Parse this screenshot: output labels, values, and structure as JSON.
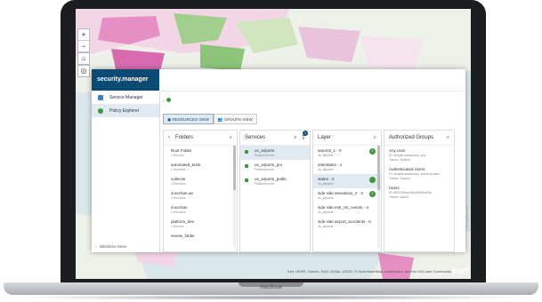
{
  "device": {
    "label": "MacBook"
  },
  "map": {
    "zoom_in": "+",
    "zoom_out": "−",
    "home": "⌂",
    "locate": "◎",
    "attribution": "Esri, HERE, Garmin, FAO, NOAA, USGS, © OpenStreetMap contributors, and the GIS User Community",
    "logo": "esri"
  },
  "app": {
    "brand": "security.manager",
    "nav": [
      {
        "label": "Service Manager"
      },
      {
        "label": "Policy Explorer"
      }
    ],
    "minimize": "Minimize menu",
    "breadcrumb": "",
    "tabs": [
      {
        "label": "RESOURCES VIEW"
      },
      {
        "label": "GROUPS VIEW"
      }
    ],
    "folders": {
      "title": "Folders",
      "items": [
        {
          "name": "Root Folder",
          "sub": "1 Service"
        },
        {
          "name": "automated_tests",
          "sub": "2 Services"
        },
        {
          "name": "collector",
          "sub": "2 Services"
        },
        {
          "name": "d-sechan-ae",
          "sub": "0 Services"
        },
        {
          "name": "d-sechan",
          "sub": "0 Services"
        },
        {
          "name": "platform_dev",
          "sub": "1 Service"
        },
        {
          "name": "review_folder",
          "sub": ""
        }
      ]
    },
    "services": {
      "title": "Services",
      "filter_count": "1",
      "items": [
        {
          "name": "us_airports",
          "sub": "FeatureServer"
        },
        {
          "name": "us_airports_pro",
          "sub": "FeatureServer"
        },
        {
          "name": "us_airports_public",
          "sub": "FeatureServer"
        }
      ]
    },
    "layers": {
      "title": "Layer",
      "items": [
        {
          "name": "airports_1 - 0",
          "sub": "us_airports",
          "badge": "2"
        },
        {
          "name": "interstates - 1",
          "sub": "us_airports"
        },
        {
          "name": "states - 2",
          "sub": "us_airports",
          "badge": ""
        },
        {
          "name": "side side elevations_2 - 3",
          "sub": "us_airports",
          "badge": "2"
        },
        {
          "name": "side side estr_nlc_events - 4",
          "sub": "us_airports"
        },
        {
          "name": "side side airport_accidents - 5",
          "sub": "us_airports"
        }
      ]
    },
    "groups": {
      "title": "Authorized Groups",
      "items": [
        {
          "name": "Any User",
          "sub1": "ID: simplerolesfactory_any",
          "sub2": "Owner: System"
        },
        {
          "name": "Authenticated Users",
          "sub1": "ID: simplerolesfactory_authenticated",
          "sub2": "Owner: System"
        },
        {
          "name": "Users",
          "sub1": "ID: f5f2f759ba0d6a3f3c5b4b5e",
          "sub2": "Owner: admin"
        }
      ]
    }
  }
}
